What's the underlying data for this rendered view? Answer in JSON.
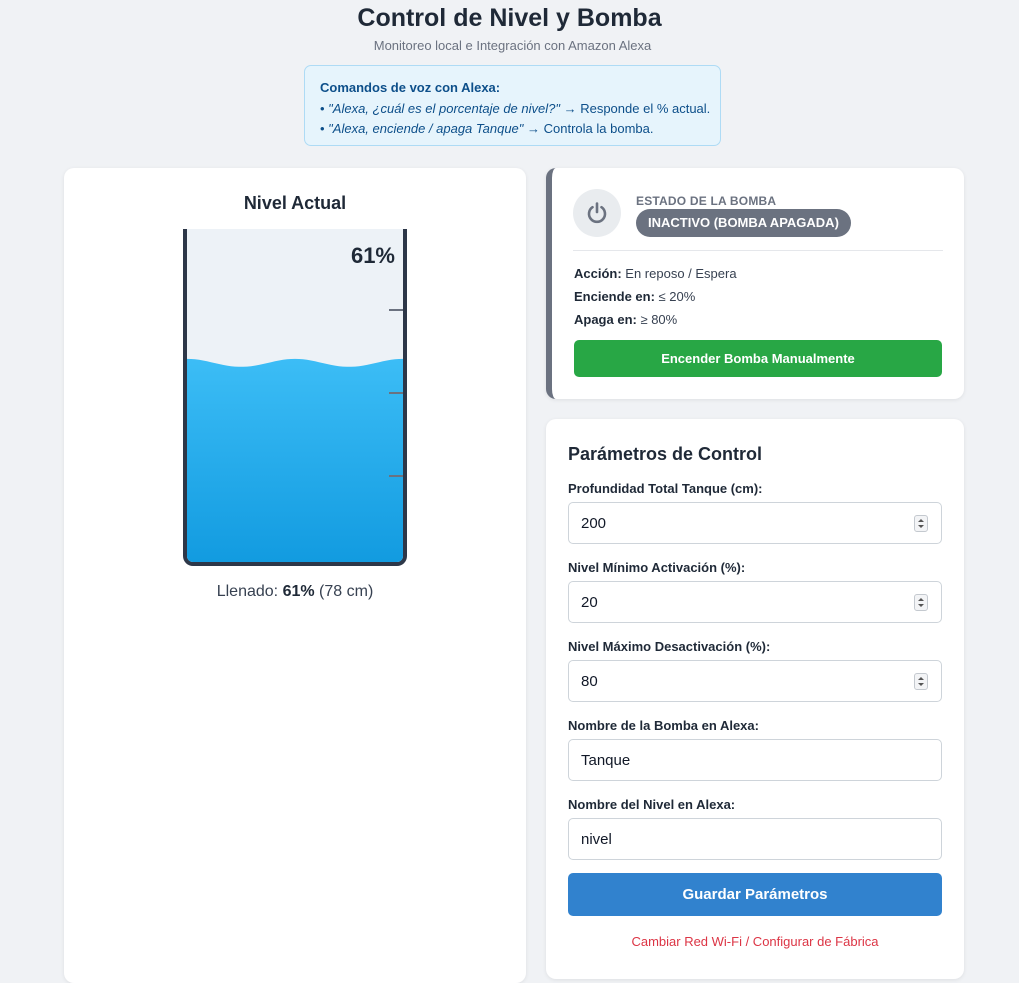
{
  "header": {
    "title": "Control de Nivel y Bomba",
    "subtitle": "Monitoreo local e Integración con Amazon Alexa"
  },
  "alexa_commands": {
    "heading": "Comandos de voz con Alexa:",
    "cmd1_prefix": "• ",
    "cmd1_quote": "\"Alexa, ¿cuál es el porcentaje de nivel?\"",
    "cmd1_result": " → Responde el % actual.",
    "cmd2_prefix": "• ",
    "cmd2_quote": "\"Alexa, enciende / apaga Tanque\"",
    "cmd2_result": " → Controla la bomba."
  },
  "level": {
    "title": "Nivel Actual",
    "percent_display": "61%",
    "fill_fraction": 0.61,
    "fill_label": "Llenado: ",
    "fill_percent": "61%",
    "fill_cm": " (78 cm)",
    "water_color_top": "#3cbdf6",
    "water_color_bottom": "#129be0"
  },
  "pump": {
    "status_label": "ESTADO DE LA BOMBA",
    "status_badge": "INACTIVO (BOMBA APAGADA)",
    "action_label": "Acción:",
    "action_value": " En reposo / Espera",
    "on_label": "Enciende en:",
    "on_value": " ≤ 20%",
    "off_label": "Apaga en:",
    "off_value": " ≥ 80%",
    "manual_button": "Encender Bomba Manualmente",
    "icon": "power-icon",
    "button_color": "#28a745"
  },
  "params": {
    "title": "Parámetros de Control",
    "depth_label": "Profundidad Total Tanque (cm):",
    "depth_value": "200",
    "min_label": "Nivel Mínimo Activación (%):",
    "min_value": "20",
    "max_label": "Nivel Máximo Desactivación (%):",
    "max_value": "80",
    "pump_name_label": "Nombre de la Bomba en Alexa:",
    "pump_name_value": "Tanque",
    "level_name_label": "Nombre del Nivel en Alexa:",
    "level_name_value": "nivel",
    "save_button": "Guardar Parámetros",
    "reset_link": "Cambiar Red Wi-Fi / Configurar de Fábrica",
    "save_color": "#3182ce",
    "reset_color": "#dc3545"
  }
}
